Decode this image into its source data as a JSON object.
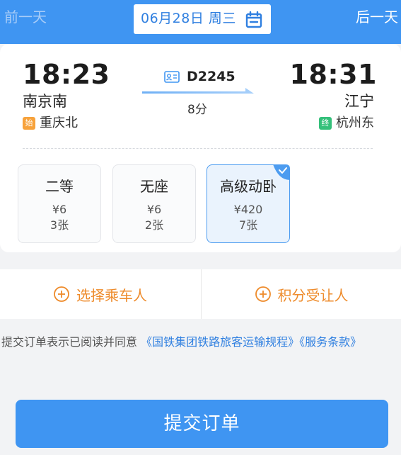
{
  "header": {
    "prev_day": "前一天",
    "next_day": "后一天",
    "date": "06月28日 周三"
  },
  "train": {
    "departure_time": "18:23",
    "departure_station": "南京南",
    "origin_tag": "始",
    "origin_station": "重庆北",
    "train_number": "D2245",
    "duration": "8分",
    "arrival_time": "18:31",
    "arrival_station": "江宁",
    "terminal_tag": "终",
    "terminal_station": "杭州东"
  },
  "seats": [
    {
      "name": "二等",
      "price": "¥6",
      "count": "3张",
      "selected": false
    },
    {
      "name": "无座",
      "price": "¥6",
      "count": "2张",
      "selected": false
    },
    {
      "name": "高级动卧",
      "price": "¥420",
      "count": "7张",
      "selected": true
    }
  ],
  "actions": {
    "select_passenger": "选择乘车人",
    "points_transfer": "积分受让人"
  },
  "terms": {
    "prefix": "提交订单表示已阅读并同意",
    "rules_link": "《国铁集团铁路旅客运输规程》",
    "service_link": "《服务条款》"
  },
  "submit_label": "提交订单",
  "colors": {
    "primary_blue": "#3f95f2",
    "link_blue": "#2f7fe0",
    "action_orange": "#ee8b2b",
    "origin_tag": "#f7a23b",
    "terminal_tag": "#34c07a"
  }
}
